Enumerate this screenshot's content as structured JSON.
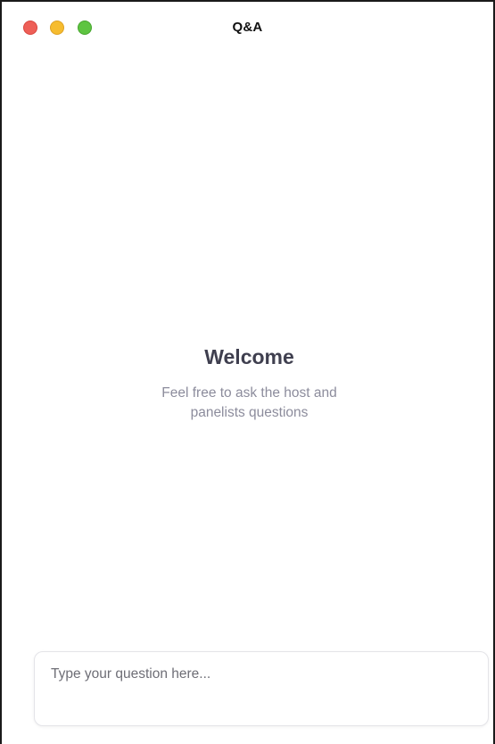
{
  "window": {
    "title": "Q&A",
    "traffic_lights": {
      "close_color": "#ee5f57",
      "minimize_color": "#f6bc2f",
      "zoom_color": "#5ec441"
    }
  },
  "empty_state": {
    "heading": "Welcome",
    "message": "Feel free to ask the host and panelists questions"
  },
  "composer": {
    "value": "",
    "placeholder": "Type your question here..."
  }
}
